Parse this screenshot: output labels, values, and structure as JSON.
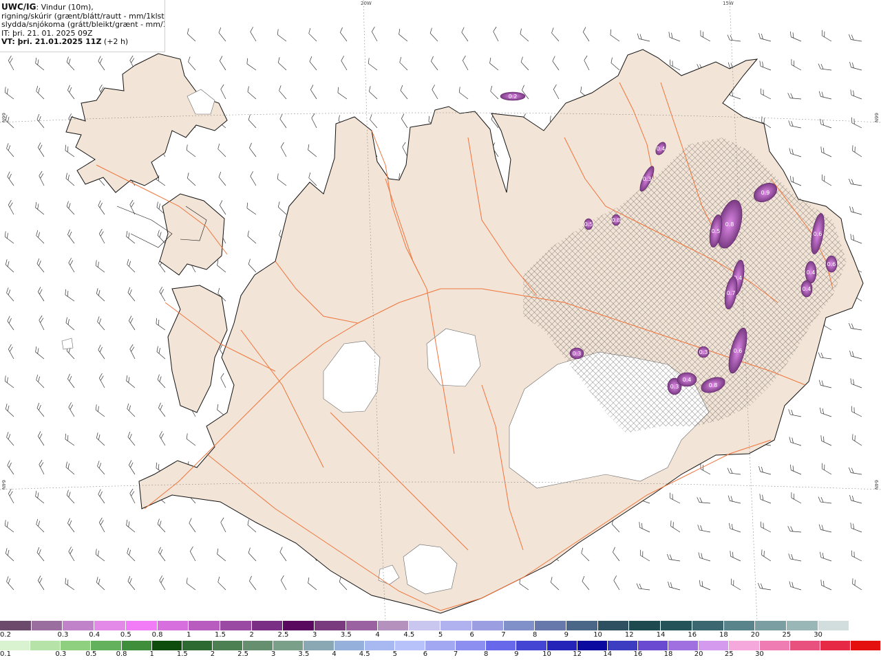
{
  "header": {
    "model": "UWC/IG",
    "title_rest": ": Vindur (10m),",
    "line2": "rigning/skúrir (grænt/blátt/rautt - mm/1klst) og",
    "line3": "slydda/snjókoma (grátt/bleikt/grænt - mm/1klst)",
    "it_line": "IT: þri. 21. 01. 2025 09Z",
    "vt_prefix": "VT: þri. 21.01.2025 11Z",
    "vt_suffix": " (+2 h)"
  },
  "grid_labels": {
    "lon_20w": "20W",
    "lon_15w": "15W",
    "lat_66n_left": "66N",
    "lat_66n_right": "66N",
    "lat_64n_left": "64N",
    "lat_64n_right": "64N"
  },
  "precip_cells": [
    {
      "label": "0.2"
    },
    {
      "label": "0.4"
    },
    {
      "label": "0.3"
    },
    {
      "label": "0.5"
    },
    {
      "label": "0.8"
    },
    {
      "label": "0.8"
    },
    {
      "label": "0.9"
    },
    {
      "label": "0.5"
    },
    {
      "label": "0.4"
    },
    {
      "label": "0.7"
    },
    {
      "label": "0.6"
    },
    {
      "label": "0.4"
    },
    {
      "label": "0.4"
    },
    {
      "label": "0.6"
    },
    {
      "label": "0.6"
    },
    {
      "label": "0.3"
    },
    {
      "label": "0.3"
    },
    {
      "label": "0.4"
    },
    {
      "label": "0.3"
    },
    {
      "label": "0.8"
    }
  ],
  "legend_snow": {
    "colors": [
      "#6b4a6b",
      "#9a6fa0",
      "#c082c8",
      "#e38ae8",
      "#f27bf7",
      "#d86fde",
      "#b85cbf",
      "#9b4aa3",
      "#7a2f84",
      "#5a0a5e",
      "#7a3b7e",
      "#9a62a0",
      "#b591bd",
      "#c9c7f0",
      "#b0b2ef",
      "#9b9ee0",
      "#8090c9",
      "#6679aa",
      "#4b6787",
      "#2f5060",
      "#1e4a4f",
      "#24545a",
      "#3b6870",
      "#5a848c",
      "#7a9ea2",
      "#9ab7b8",
      "#d2dedd",
      "#ffffff"
    ],
    "labels": [
      "0.2",
      "0.3",
      "0.4",
      "0.5",
      "0.8",
      "1",
      "1.5",
      "2",
      "2.5",
      "3",
      "3.5",
      "4",
      "4.5",
      "5",
      "6",
      "7",
      "8",
      "9",
      "10",
      "12",
      "14",
      "16",
      "18",
      "20",
      "25",
      "30"
    ]
  },
  "legend_rain": {
    "colors": [
      "#d9f2d0",
      "#b6e3a8",
      "#8fcf80",
      "#63b15c",
      "#3f8e3c",
      "#0e4d0e",
      "#2c6a32",
      "#4c8052",
      "#658f6f",
      "#7aa08a",
      "#8aa7b4",
      "#96b0dc",
      "#a8b9f2",
      "#b7c2fa",
      "#a3a8f2",
      "#8c8ef0",
      "#6868ea",
      "#4545d4",
      "#2424b8",
      "#0b0ba0",
      "#3d3dc2",
      "#6a4ad0",
      "#a06fe0",
      "#d49aee",
      "#f4a8dc",
      "#f07cb4",
      "#e8507e",
      "#e62a46",
      "#e41010"
    ],
    "labels": [
      "0.1",
      "0.3",
      "0.5",
      "0.8",
      "1",
      "1.5",
      "2",
      "2.5",
      "3",
      "3.5",
      "4",
      "4.5",
      "5",
      "6",
      "7",
      "8",
      "9",
      "10",
      "12",
      "14",
      "16",
      "18",
      "20",
      "25",
      "30"
    ]
  },
  "colors": {
    "land": "#f2e4d6",
    "coast": "#111111",
    "roads": "#f0743c",
    "glacier": "#ffffff",
    "snow_cell": "#8a3f96",
    "graticule": "#777777"
  }
}
